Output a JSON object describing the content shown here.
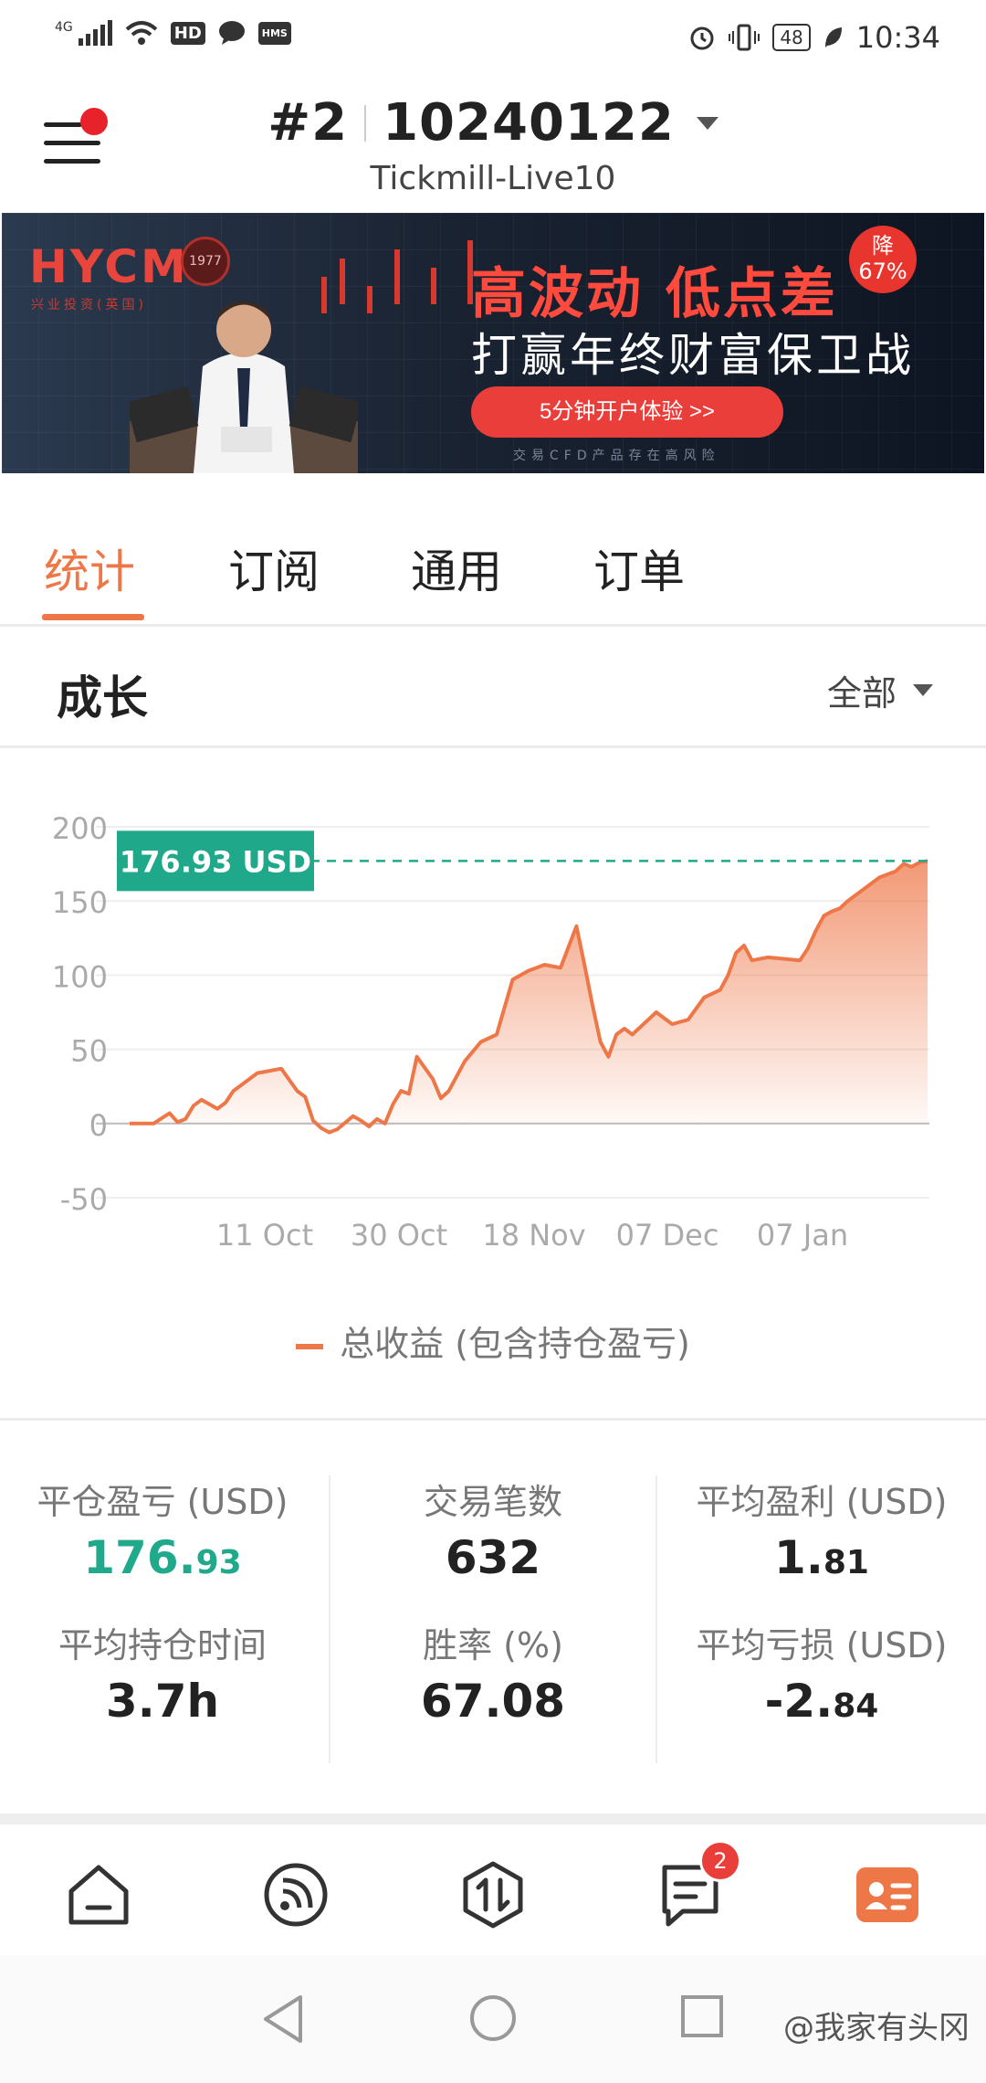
{
  "status_bar": {
    "network": "4G",
    "hd_label": "HD",
    "hms_label": "HMS",
    "battery": "48",
    "time": "10:34",
    "icons": [
      "signal-icon",
      "wifi-icon",
      "hd-icon",
      "message-icon",
      "hms-icon",
      "alarm-icon",
      "vibrate-icon",
      "battery-icon",
      "leaf-icon"
    ]
  },
  "header": {
    "account_number": "#2",
    "account_id": "10240122",
    "server": "Tickmill-Live10"
  },
  "banner": {
    "logo": "HYCM",
    "logo_sub": "兴业投资(英国)",
    "seal": "1977",
    "headline": "高波动 低点差",
    "badge_line1": "降",
    "badge_line2": "67%",
    "subline": "打赢年终财富保卫战",
    "cta": "5分钟开户体验 >>",
    "disclaimer": "交易CFD产品存在高风险"
  },
  "tabs": [
    {
      "label": "统计",
      "active": true
    },
    {
      "label": "订阅",
      "active": false
    },
    {
      "label": "通用",
      "active": false
    },
    {
      "label": "订单",
      "active": false
    }
  ],
  "section": {
    "title": "成长",
    "filter": "全部"
  },
  "chart_data": {
    "type": "area",
    "current_value_label": "176.93 USD",
    "y_ticks": [
      "200",
      "150",
      "100",
      "50",
      "0",
      "-50"
    ],
    "x_ticks": [
      "11 Oct",
      "30 Oct",
      "18 Nov",
      "07 Dec",
      "07 Jan"
    ],
    "ylim": [
      -50,
      200
    ],
    "series": [
      {
        "name": "总收益 (包含持仓盈亏)",
        "color": "#ee7748",
        "x": [
          0,
          3,
          5,
          6,
          7,
          8,
          9,
          11,
          12,
          13,
          14,
          15,
          16,
          17,
          19,
          21,
          22,
          23,
          24,
          25,
          26,
          28,
          29,
          30,
          31,
          32,
          33,
          34,
          35,
          36,
          38,
          39,
          40,
          42,
          44,
          46,
          48,
          50,
          52,
          54,
          56,
          57,
          58,
          59,
          60,
          61,
          62,
          63,
          64,
          66,
          68,
          70,
          72,
          74,
          75,
          76,
          77,
          78,
          80,
          82,
          84,
          85,
          86,
          87,
          88,
          89,
          90,
          92,
          94,
          96,
          97,
          98,
          99,
          100
        ],
        "values": [
          0,
          0,
          7,
          1,
          3,
          12,
          16,
          10,
          14,
          22,
          26,
          30,
          34,
          35,
          37,
          22,
          18,
          2,
          -3,
          -6,
          -4,
          5,
          2,
          -2,
          3,
          0,
          13,
          22,
          20,
          45,
          30,
          17,
          22,
          42,
          55,
          60,
          97,
          103,
          107,
          105,
          133,
          107,
          80,
          55,
          45,
          60,
          64,
          60,
          65,
          75,
          67,
          70,
          85,
          90,
          100,
          115,
          120,
          110,
          112,
          111,
          110,
          118,
          130,
          140,
          143,
          145,
          150,
          158,
          166,
          170,
          175,
          173,
          176,
          177
        ]
      }
    ],
    "legend": "总收益 (包含持仓盈亏)"
  },
  "stats": [
    {
      "label": "平仓盈亏 (USD)",
      "int": "176.",
      "dec": "93",
      "green": true
    },
    {
      "label": "交易笔数",
      "int": "632",
      "dec": "",
      "green": false
    },
    {
      "label": "平均盈利 (USD)",
      "int": "1.",
      "dec": "81",
      "green": false
    },
    {
      "label": "平均持仓时间",
      "int": "3.7h",
      "dec": "",
      "green": false
    },
    {
      "label": "胜率 (%)",
      "int": "67.08",
      "dec": "",
      "green": false
    },
    {
      "label": "平均亏损 (USD)",
      "int": "-2.",
      "dec": "84",
      "green": false
    }
  ],
  "bottom_nav": {
    "items": [
      "home-icon",
      "feed-icon",
      "trade-icon",
      "messages-icon",
      "profile-icon"
    ],
    "messages_badge": "2",
    "active_color": "#ee7748"
  },
  "watermark": "@我家有头冈"
}
